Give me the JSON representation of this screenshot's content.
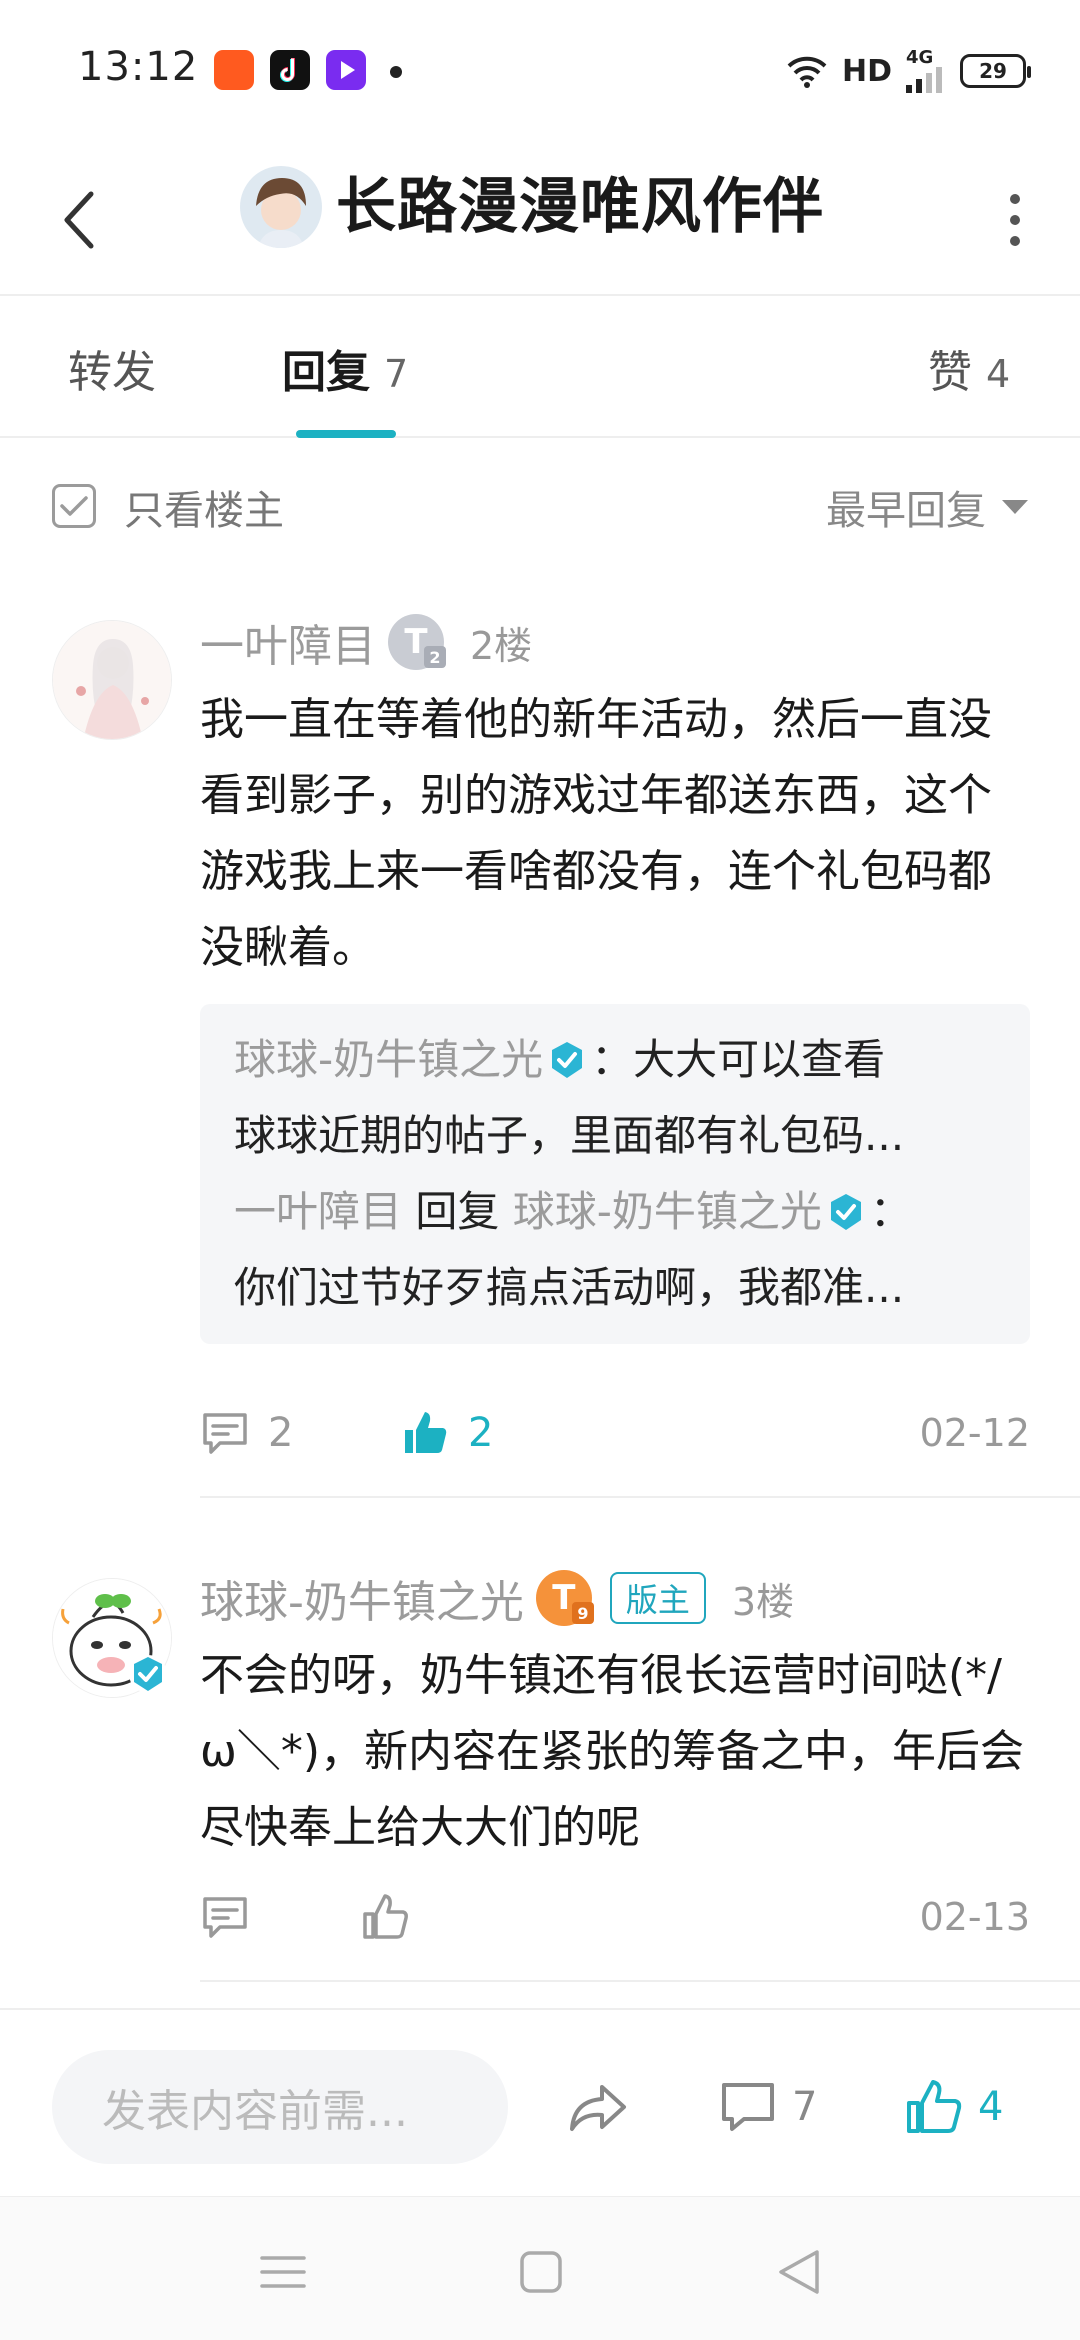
{
  "status_bar": {
    "time": "13:12",
    "network": "HD",
    "network_gen": "4G",
    "battery": "29"
  },
  "header": {
    "title": "长路漫漫唯风作伴"
  },
  "tabs": [
    {
      "label": "转发",
      "count": ""
    },
    {
      "label": "回复",
      "count": "7"
    },
    {
      "label": "赞",
      "count": "4"
    }
  ],
  "filter": {
    "only_owner_label": "只看楼主",
    "sort_label": "最早回复"
  },
  "comments": [
    {
      "author": "一叶障目",
      "level": "T",
      "level_num": "2",
      "floor": "2楼",
      "text": "我一直在等着他的新年活动，然后一直没看到影子，别的游戏过年都送东西，这个游戏我上来一看啥都没有，连个礼包码都没瞅着。",
      "replies": [
        {
          "author": "球球-奶牛镇之光",
          "reply_word": "",
          "target": "",
          "text_1": "：大大可以查看",
          "text_2": "球球近期的帖子，里面都有礼包码..."
        },
        {
          "author": "一叶障目",
          "reply_word": "回复",
          "target": "球球-奶牛镇之光",
          "text_1": "：",
          "text_2": "你们过节好歹搞点活动啊，我都准..."
        }
      ],
      "reply_count": "2",
      "like_count": "2",
      "date": "02-12"
    },
    {
      "author": "球球-奶牛镇之光",
      "level": "T",
      "level_num": "9",
      "mod_tag": "版主",
      "floor": "3楼",
      "text": "不会的呀，奶牛镇还有很长运营时间哒(*/ω＼*)，新内容在紧张的筹备之中，年后会尽快奉上给大大们的呢",
      "reply_count": "",
      "like_count": "",
      "date": "02-13"
    }
  ],
  "bottom_bar": {
    "input_placeholder": "发表内容前需...",
    "comment_count": "7",
    "like_count": "4"
  },
  "colors": {
    "accent": "#1cb1c2",
    "verified": "#2bb5d4",
    "level_grey": "#c9ccd3",
    "level_orange": "#f5923a"
  }
}
